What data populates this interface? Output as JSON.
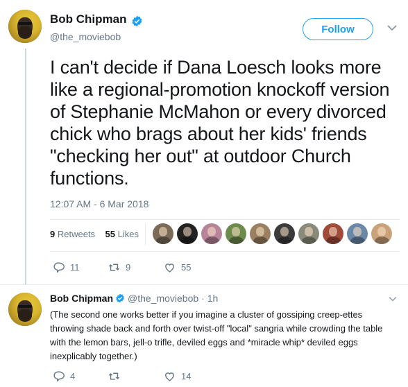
{
  "tweet": {
    "author_name": "Bob Chipman",
    "author_handle": "@the_moviebob",
    "follow_label": "Follow",
    "text": "I can't decide if Dana Loesch looks more like a regional-promotion knockoff version of Stephanie McMahon or every divorced chick who brags about her kids' friends \"checking her out\" at outdoor Church functions.",
    "timestamp": "12:07 AM - 6 Mar 2018",
    "retweets_count": "9",
    "retweets_label": "Retweets",
    "likes_count": "55",
    "likes_label": "Likes",
    "actions": {
      "replies": "11",
      "retweets": "9",
      "likes": "55"
    }
  },
  "reply": {
    "author_name": "Bob Chipman",
    "author_handle": "@the_moviebob",
    "time": "· 1h",
    "text": "(The second one works better if you imagine a cluster of gossiping creep-ettes throwing shade back and forth over twist-off \"local\" sangria while crowding the table with the lemon bars, jell-o trifle, deviled eggs and *miracle whip* deviled eggs inexplicably together.)",
    "actions": {
      "replies": "4",
      "retweets": "",
      "likes": "14"
    }
  },
  "likers": [
    {
      "icon": "liker-avatar",
      "color": "#7a6a58"
    },
    {
      "icon": "liker-avatar",
      "color": "#222222"
    },
    {
      "icon": "liker-avatar",
      "color": "#b8849a"
    },
    {
      "icon": "liker-avatar",
      "color": "#6e8b4e"
    },
    {
      "icon": "liker-avatar",
      "color": "#9a8060"
    },
    {
      "icon": "liker-avatar",
      "color": "#3b3b3b"
    },
    {
      "icon": "liker-avatar",
      "color": "#8a8a7a"
    },
    {
      "icon": "liker-avatar",
      "color": "#a04a3a"
    },
    {
      "icon": "liker-avatar",
      "color": "#6a88a8"
    },
    {
      "icon": "liker-avatar",
      "color": "#c9a27a"
    }
  ],
  "colors": {
    "accent": "#1da1f2",
    "muted": "#657786",
    "text": "#14171a",
    "line": "#ccd6dd"
  }
}
